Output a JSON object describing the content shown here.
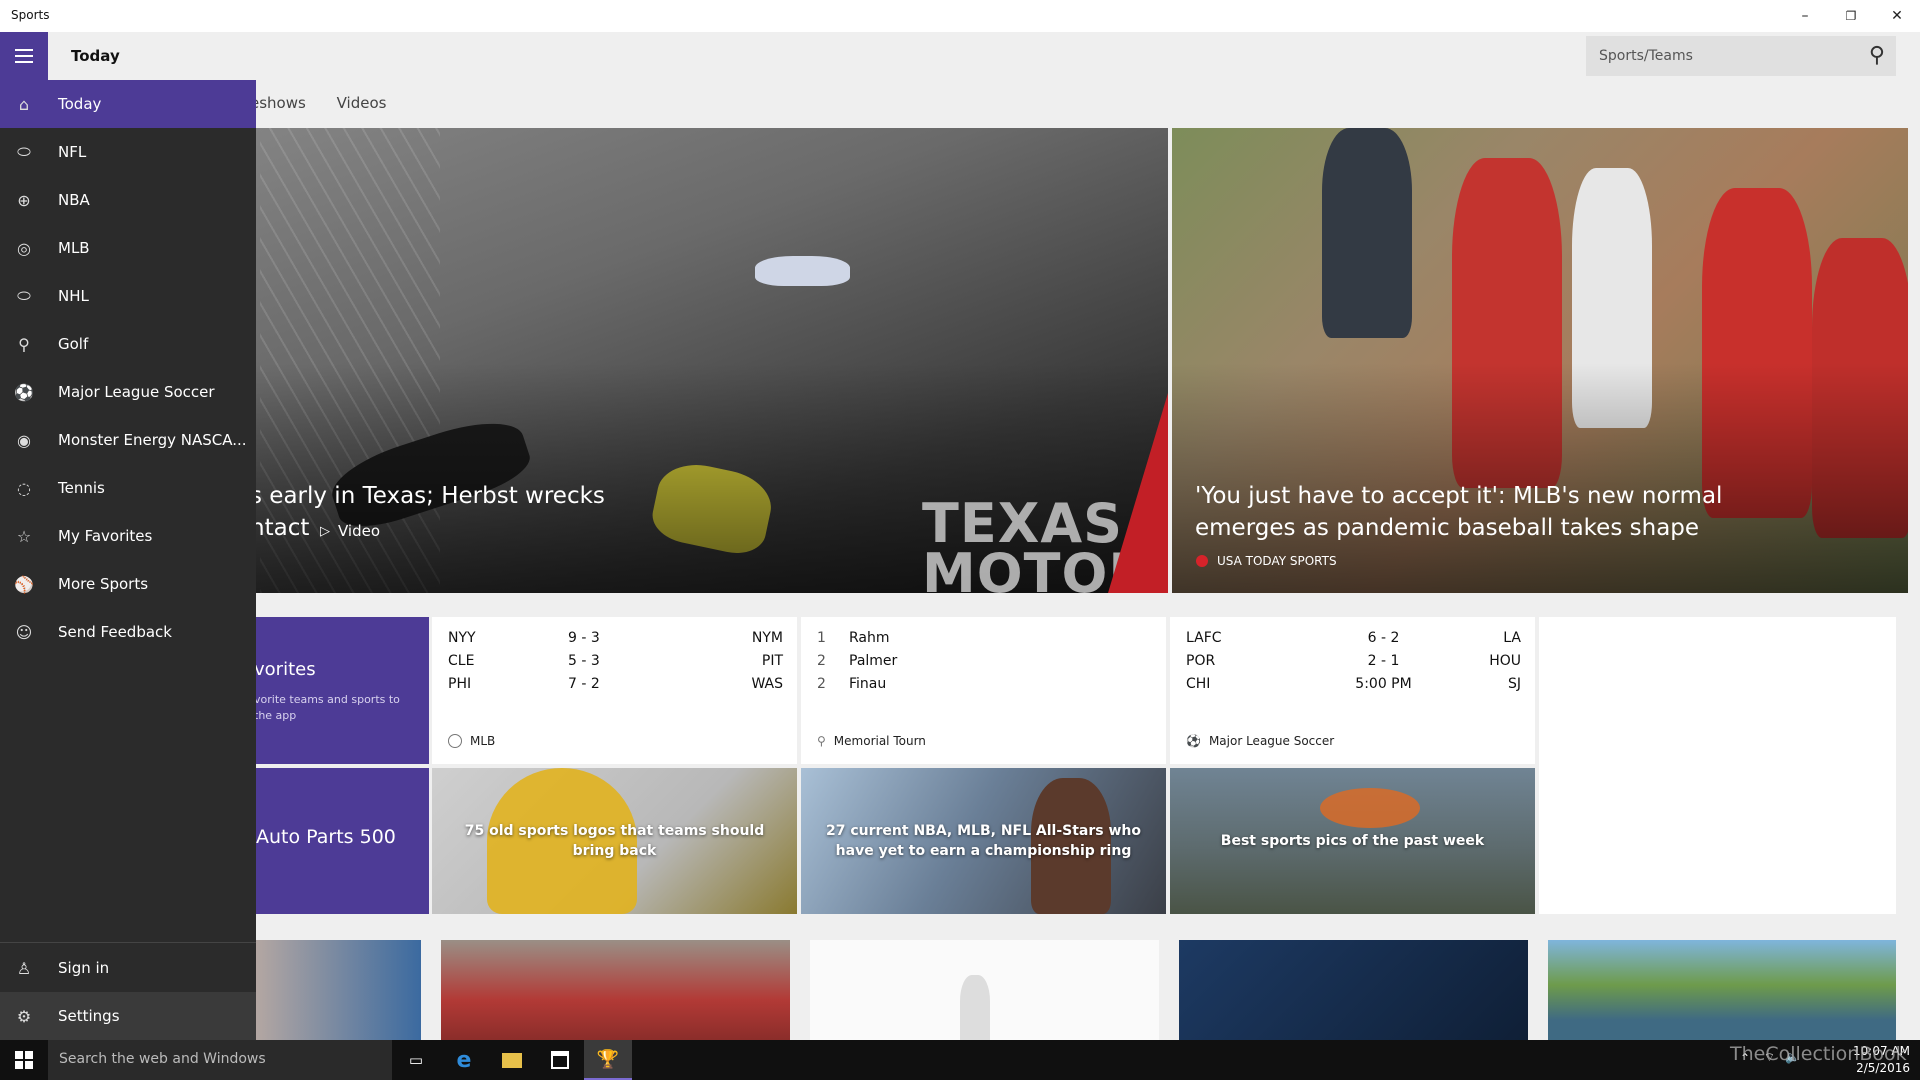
{
  "window": {
    "title": "Sports",
    "minimize": "–",
    "restore": "❐",
    "close": "✕"
  },
  "header": {
    "page_title": "Today",
    "search_placeholder": "Sports/Teams"
  },
  "subnav": {
    "tabs": [
      "eshows",
      "Videos"
    ]
  },
  "hero": [
    {
      "title_line1": "s early in Texas; Herbst wrecks",
      "title_line2": "ntact",
      "video_label": "Video",
      "badge": "TEXAS MOTOR"
    },
    {
      "title_line1": "'You just have to accept it': MLB's new normal",
      "title_line2": "emerges as pandemic baseball takes shape",
      "source": "USA TODAY SPORTS"
    }
  ],
  "favorites_tile": {
    "title": "vorites",
    "sub_line1": "vorite teams and sports to",
    "sub_line2": "the app"
  },
  "nascar_tile": {
    "title": "Auto Parts 500"
  },
  "scores": [
    {
      "league": "MLB",
      "rows": [
        [
          "NYY",
          "9 - 3",
          "NYM"
        ],
        [
          "CLE",
          "5 - 3",
          "PIT"
        ],
        [
          "PHI",
          "7 - 2",
          "WAS"
        ]
      ]
    },
    {
      "league": "Memorial Tourn",
      "rows": [
        [
          "1",
          "Rahm",
          ""
        ],
        [
          "2",
          "Palmer",
          ""
        ],
        [
          "2",
          "Finau",
          ""
        ]
      ]
    },
    {
      "league": "Major League Soccer",
      "rows": [
        [
          "LAFC",
          "6 - 2",
          "LA"
        ],
        [
          "POR",
          "2 - 1",
          "HOU"
        ],
        [
          "CHI",
          "5:00 PM",
          "SJ"
        ]
      ]
    }
  ],
  "photo_tiles": [
    {
      "caption": "75 old sports logos that teams should bring back"
    },
    {
      "caption": "27 current NBA, MLB, NFL All-Stars who have yet to earn a championship ring"
    },
    {
      "caption": "Best sports pics of the past week"
    }
  ],
  "sidebar": {
    "items": [
      {
        "label": "Today",
        "icon": "⌂"
      },
      {
        "label": "NFL",
        "icon": "⬭"
      },
      {
        "label": "NBA",
        "icon": "⊕"
      },
      {
        "label": "MLB",
        "icon": "◎"
      },
      {
        "label": "NHL",
        "icon": "⬭"
      },
      {
        "label": "Golf",
        "icon": "⚲"
      },
      {
        "label": "Major League Soccer",
        "icon": "⚽"
      },
      {
        "label": "Monster Energy NASCA...",
        "icon": "◉"
      },
      {
        "label": "Tennis",
        "icon": "◌"
      },
      {
        "label": "My Favorites",
        "icon": "☆"
      },
      {
        "label": "More Sports",
        "icon": "⚾"
      },
      {
        "label": "Send Feedback",
        "icon": "☺"
      }
    ],
    "bottom": [
      {
        "label": "Sign in",
        "icon": "♙"
      },
      {
        "label": "Settings",
        "icon": "⚙"
      }
    ]
  },
  "taskbar": {
    "search_placeholder": "Search the web and Windows",
    "time": "10:07 AM",
    "date": "2/5/2016",
    "watermark": "TheCollectionBook"
  },
  "colors": {
    "accent": "#4d3b96",
    "sidebar": "#2b2b2b",
    "taskbar": "#101010"
  }
}
